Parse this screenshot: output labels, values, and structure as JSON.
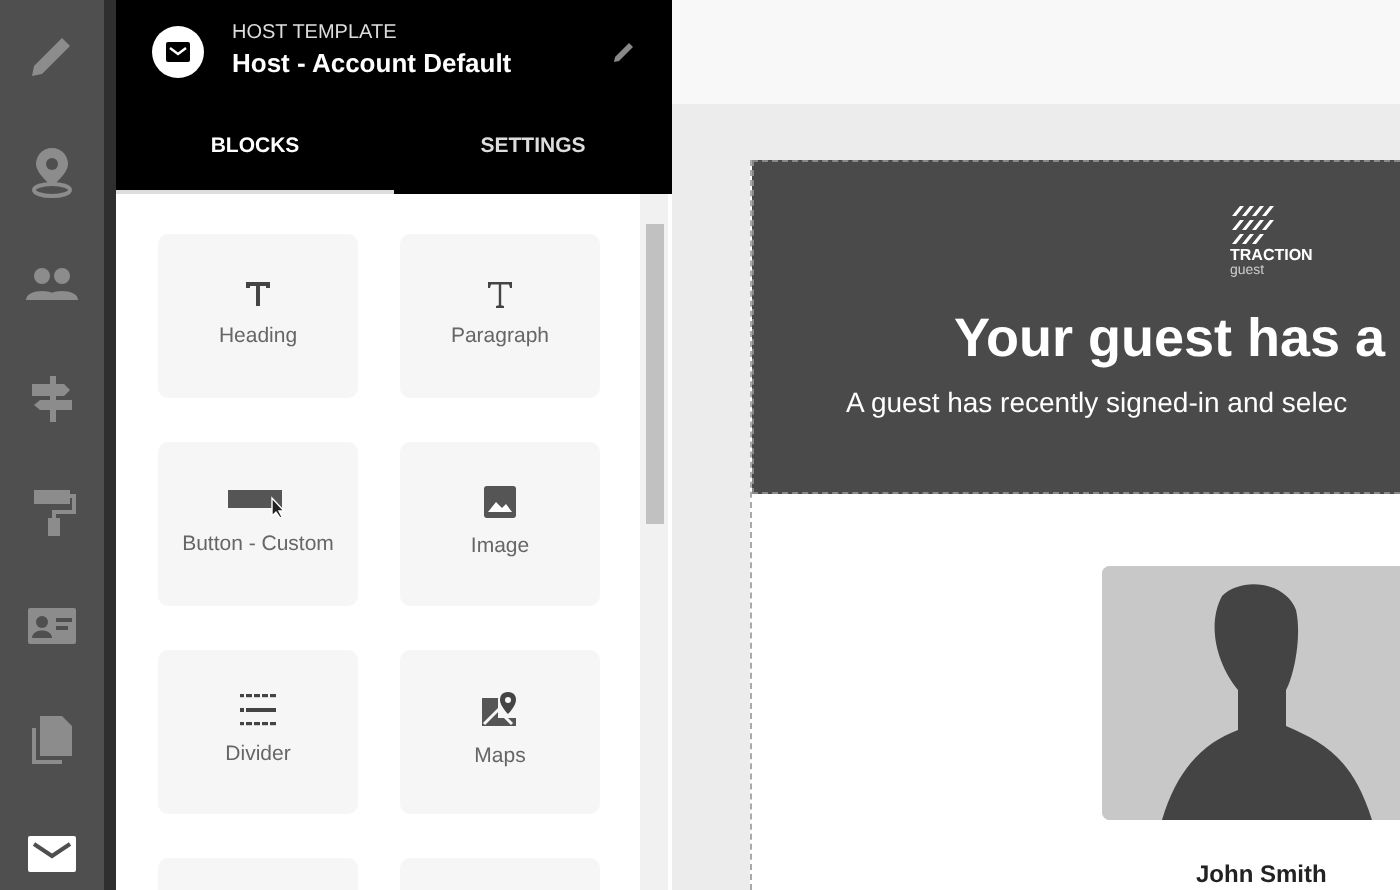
{
  "rail": [
    {
      "kind": "pencil",
      "selected": false
    },
    {
      "kind": "pin",
      "selected": false
    },
    {
      "kind": "people",
      "selected": false
    },
    {
      "kind": "signpost",
      "selected": false
    },
    {
      "kind": "roller",
      "selected": false
    },
    {
      "kind": "card",
      "selected": false
    },
    {
      "kind": "documents",
      "selected": false
    },
    {
      "kind": "mail",
      "selected": true
    }
  ],
  "panel": {
    "overline": "HOST TEMPLATE",
    "title": "Host - Account Default",
    "tabs": [
      {
        "label": "BLOCKS",
        "selected": true
      },
      {
        "label": "SETTINGS",
        "selected": false
      }
    ],
    "blocks": [
      {
        "kind": "heading",
        "label": "Heading"
      },
      {
        "kind": "paragraph",
        "label": "Paragraph"
      },
      {
        "kind": "button",
        "label": "Button - Custom"
      },
      {
        "kind": "image",
        "label": "Image"
      },
      {
        "kind": "divider",
        "label": "Divider"
      },
      {
        "kind": "maps",
        "label": "Maps"
      },
      {
        "kind": "blank"
      },
      {
        "kind": "blank"
      }
    ]
  },
  "email": {
    "logo_name": "TRACTION",
    "logo_tagline": "guest",
    "headline": "Your guest has a",
    "subtext": "A guest has recently signed-in and selec",
    "guest_name": "John Smith"
  }
}
